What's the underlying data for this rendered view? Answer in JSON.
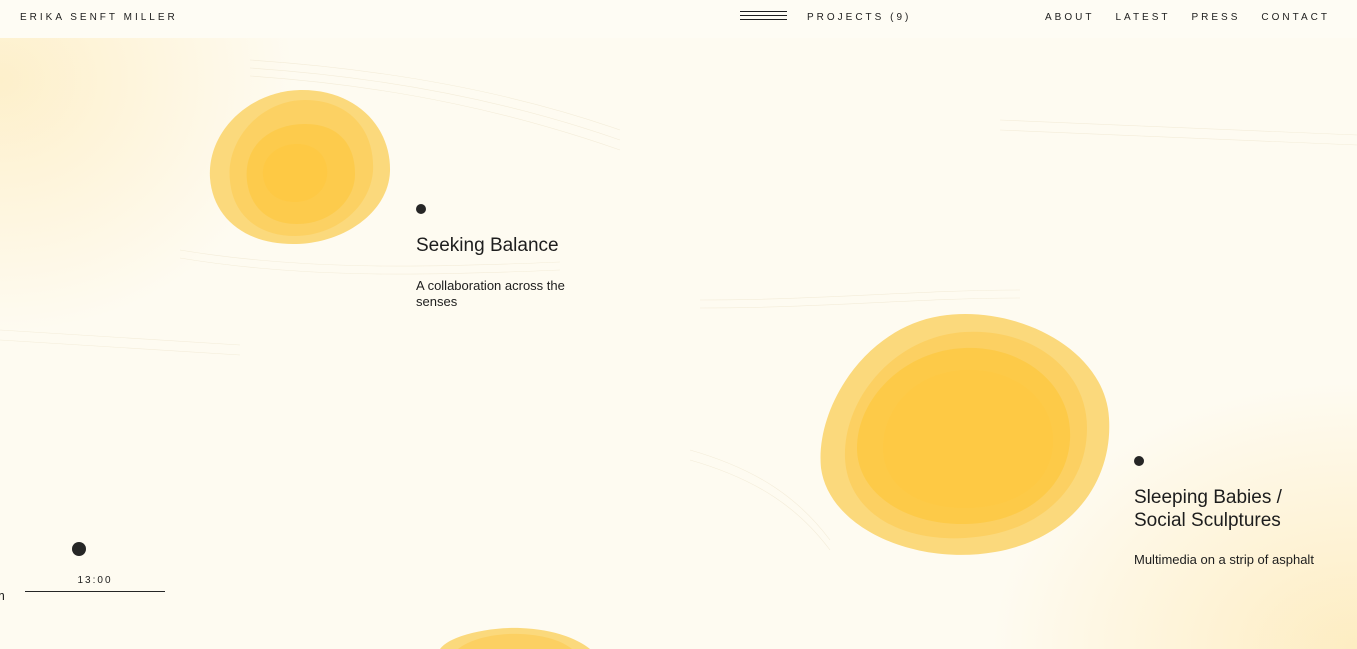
{
  "header": {
    "brand": "ERIKA SENFT MILLER",
    "projects_label": "PROJECTS (9)",
    "nav": [
      "ABOUT",
      "LATEST",
      "PRESS",
      "CONTACT"
    ]
  },
  "projects": [
    {
      "title": "Seeking Balance",
      "description": "A collaboration across the senses"
    },
    {
      "title": "Sleeping Babies / Social Sculptures",
      "description": "Multimedia on a strip of asphalt"
    }
  ],
  "timeline": {
    "time": "13:00",
    "edge_text": "m"
  },
  "colors": {
    "background": "#fefbf1",
    "blob_outer": "#fbd97c",
    "blob_mid": "#fccf5a",
    "blob_inner": "#fec944",
    "text": "#1d1d1d"
  }
}
